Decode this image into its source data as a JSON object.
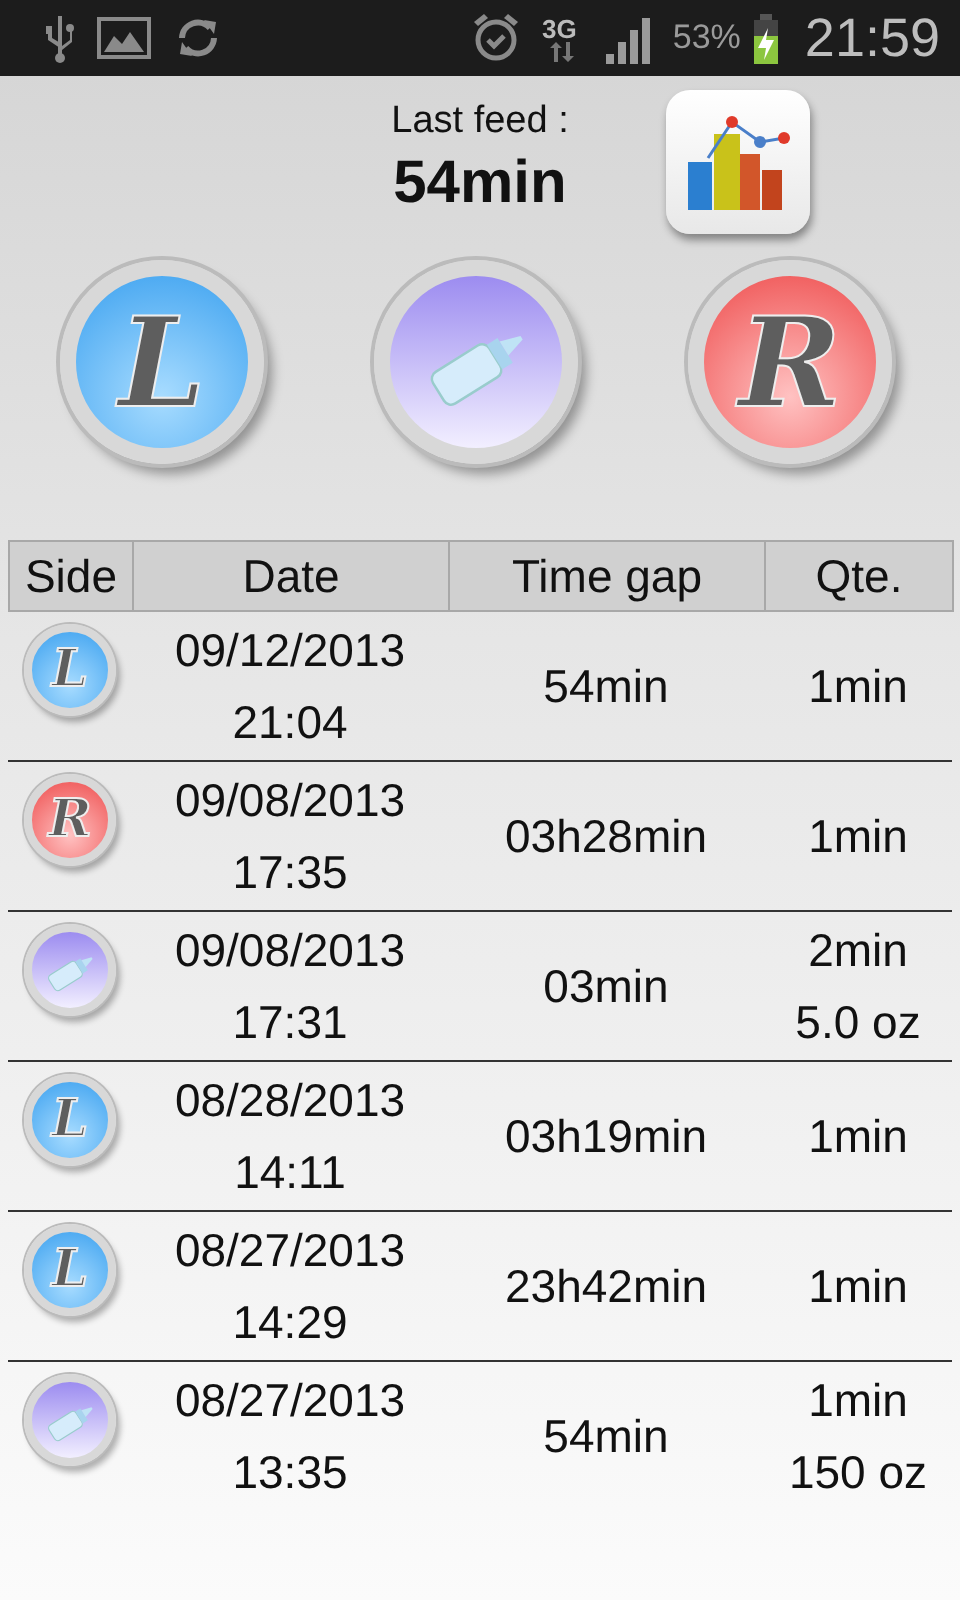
{
  "status_bar": {
    "network": "3G",
    "battery": "53%",
    "time": "21:59"
  },
  "header": {
    "label": "Last feed :",
    "value": "54min"
  },
  "feed_buttons": [
    {
      "kind": "left",
      "letter": "L"
    },
    {
      "kind": "bottle"
    },
    {
      "kind": "right",
      "letter": "R"
    }
  ],
  "table": {
    "columns": [
      "Side",
      "Date",
      "Time gap",
      "Qte."
    ],
    "rows": [
      {
        "side": {
          "kind": "left",
          "letter": "L"
        },
        "date": "09/12/2013",
        "time": "21:04",
        "gap": "54min",
        "qty": [
          "1min"
        ]
      },
      {
        "side": {
          "kind": "right",
          "letter": "R"
        },
        "date": "09/08/2013",
        "time": "17:35",
        "gap": "03h28min",
        "qty": [
          "1min"
        ]
      },
      {
        "side": {
          "kind": "bottle"
        },
        "date": "09/08/2013",
        "time": "17:31",
        "gap": "03min",
        "qty": [
          "2min",
          "5.0 oz"
        ]
      },
      {
        "side": {
          "kind": "left",
          "letter": "L"
        },
        "date": "08/28/2013",
        "time": "14:11",
        "gap": "03h19min",
        "qty": [
          "1min"
        ]
      },
      {
        "side": {
          "kind": "left",
          "letter": "L"
        },
        "date": "08/27/2013",
        "time": "14:29",
        "gap": "23h42min",
        "qty": [
          "1min"
        ]
      },
      {
        "side": {
          "kind": "bottle"
        },
        "date": "08/27/2013",
        "time": "13:35",
        "gap": "54min",
        "qty": [
          "1min",
          "150 oz"
        ]
      }
    ]
  }
}
